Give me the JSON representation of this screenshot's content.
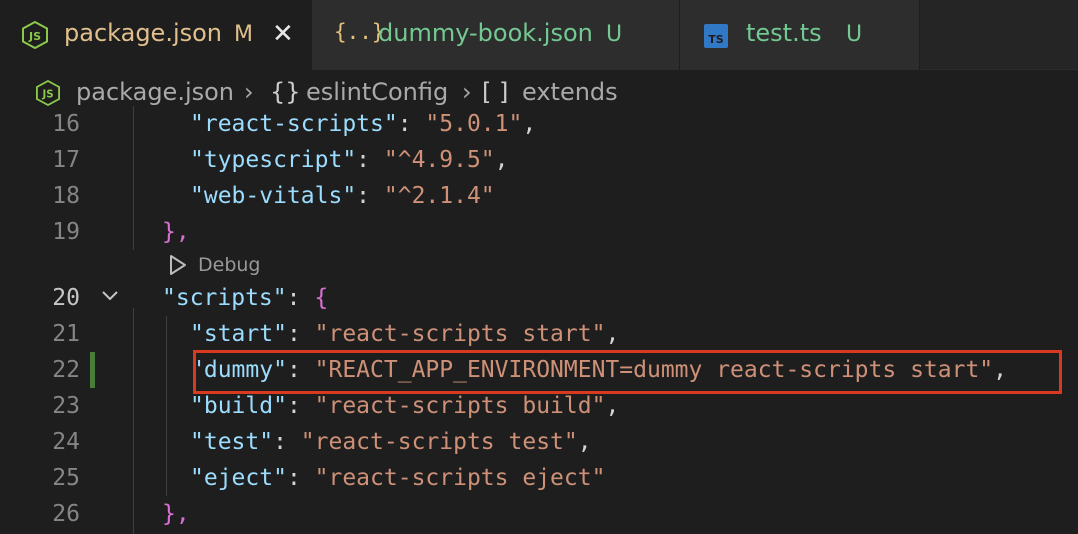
{
  "tabs": [
    {
      "name": "package.json",
      "status": "M",
      "icon": "nodejs-icon",
      "active": true,
      "close": "✕",
      "color": "#e2c08d"
    },
    {
      "name": "dummy-book.json",
      "status": "U",
      "icon": "json-braces-icon",
      "active": false,
      "color": "#73c991"
    },
    {
      "name": "test.ts",
      "status": "U",
      "icon": "typescript-icon",
      "active": false,
      "color": "#73c991"
    }
  ],
  "breadcrumb": {
    "items": [
      "package.json",
      "eslintConfig",
      "extends"
    ],
    "icons": [
      "nodejs-icon",
      "object-braces-icon",
      "array-brackets-icon"
    ]
  },
  "editor": {
    "codelens": "Debug",
    "lines": [
      {
        "n": "16",
        "key": "\"react-scripts\"",
        "val": "\"5.0.1\"",
        "tail": ","
      },
      {
        "n": "17",
        "key": "\"typescript\"",
        "val": "\"^4.9.5\"",
        "tail": ","
      },
      {
        "n": "18",
        "key": "\"web-vitals\"",
        "val": "\"^2.1.4\"",
        "tail": ""
      },
      {
        "n": "19",
        "text": "},"
      },
      {
        "n": "20",
        "key": "\"scripts\"",
        "open": "{"
      },
      {
        "n": "21",
        "key": "\"start\"",
        "val": "\"react-scripts start\"",
        "tail": ","
      },
      {
        "n": "22",
        "key": "\"dummy\"",
        "val": "\"REACT_APP_ENVIRONMENT=dummy react-scripts start\"",
        "tail": ","
      },
      {
        "n": "23",
        "key": "\"build\"",
        "val": "\"react-scripts build\"",
        "tail": ","
      },
      {
        "n": "24",
        "key": "\"test\"",
        "val": "\"react-scripts test\"",
        "tail": ","
      },
      {
        "n": "25",
        "key": "\"eject\"",
        "val": "\"react-scripts eject\"",
        "tail": ""
      },
      {
        "n": "26",
        "text": "},"
      }
    ],
    "colors": {
      "key": "#9cdcfe",
      "string": "#ce9178",
      "bracket": "#da70d6",
      "highlight": "#d8391f",
      "modified_gutter": "#487e3a"
    }
  }
}
